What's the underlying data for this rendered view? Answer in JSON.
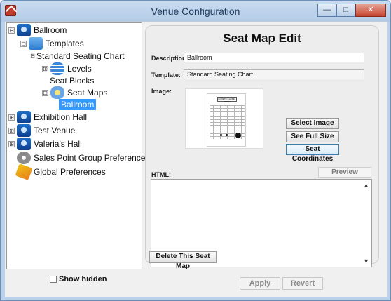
{
  "window": {
    "title": "Venue Configuration",
    "minimize_glyph": "—",
    "maximize_glyph": "□",
    "close_glyph": "✕"
  },
  "tree": {
    "expander_minus": "⊟",
    "expander_plus": "⊞",
    "nodes": [
      {
        "label": "Ballroom",
        "icon": "venue-icon",
        "expanded": true
      },
      {
        "label": "Templates",
        "icon": "templates-icon",
        "expanded": true
      },
      {
        "label": "Standard Seating Chart",
        "icon": "",
        "expanded": true
      },
      {
        "label": "Levels",
        "icon": "levels-icon",
        "expanded": false
      },
      {
        "label": "Seat Blocks",
        "icon": ""
      },
      {
        "label": "Seat Maps",
        "icon": "seat-maps-icon",
        "expanded": true
      },
      {
        "label": "Ballroom",
        "icon": "",
        "selected": true
      },
      {
        "label": "Exhibition Hall",
        "icon": "venue-icon",
        "expanded": false
      },
      {
        "label": "Test Venue",
        "icon": "venue-icon",
        "expanded": false
      },
      {
        "label": "Valeria's Hall",
        "icon": "venue-icon",
        "expanded": false
      },
      {
        "label": "Sales Point Group Preferences",
        "icon": "gear-icon"
      },
      {
        "label": "Global Preferences",
        "icon": "globe-icon"
      }
    ]
  },
  "show_hidden": {
    "label": "Show hidden",
    "checked": false
  },
  "panel": {
    "title": "Seat Map Edit",
    "description": {
      "label": "Description:",
      "value": "Ballroom"
    },
    "template": {
      "label": "Template:",
      "value": "Standard Seating Chart"
    },
    "image": {
      "label": "Image:",
      "preview_heading": "LORETO CHAPEL ALTAR"
    },
    "buttons": {
      "select_image": "Select Image",
      "see_full_size": "See Full Size",
      "seat_coordinates": "Seat Coordinates"
    },
    "html": {
      "label": "HTML:",
      "preview_tab": "Preview",
      "value": "",
      "scroll_up": "▲",
      "scroll_down": "▼"
    },
    "delete_button": "Delete This Seat Map"
  },
  "footer": {
    "apply": "Apply",
    "revert": "Revert"
  }
}
